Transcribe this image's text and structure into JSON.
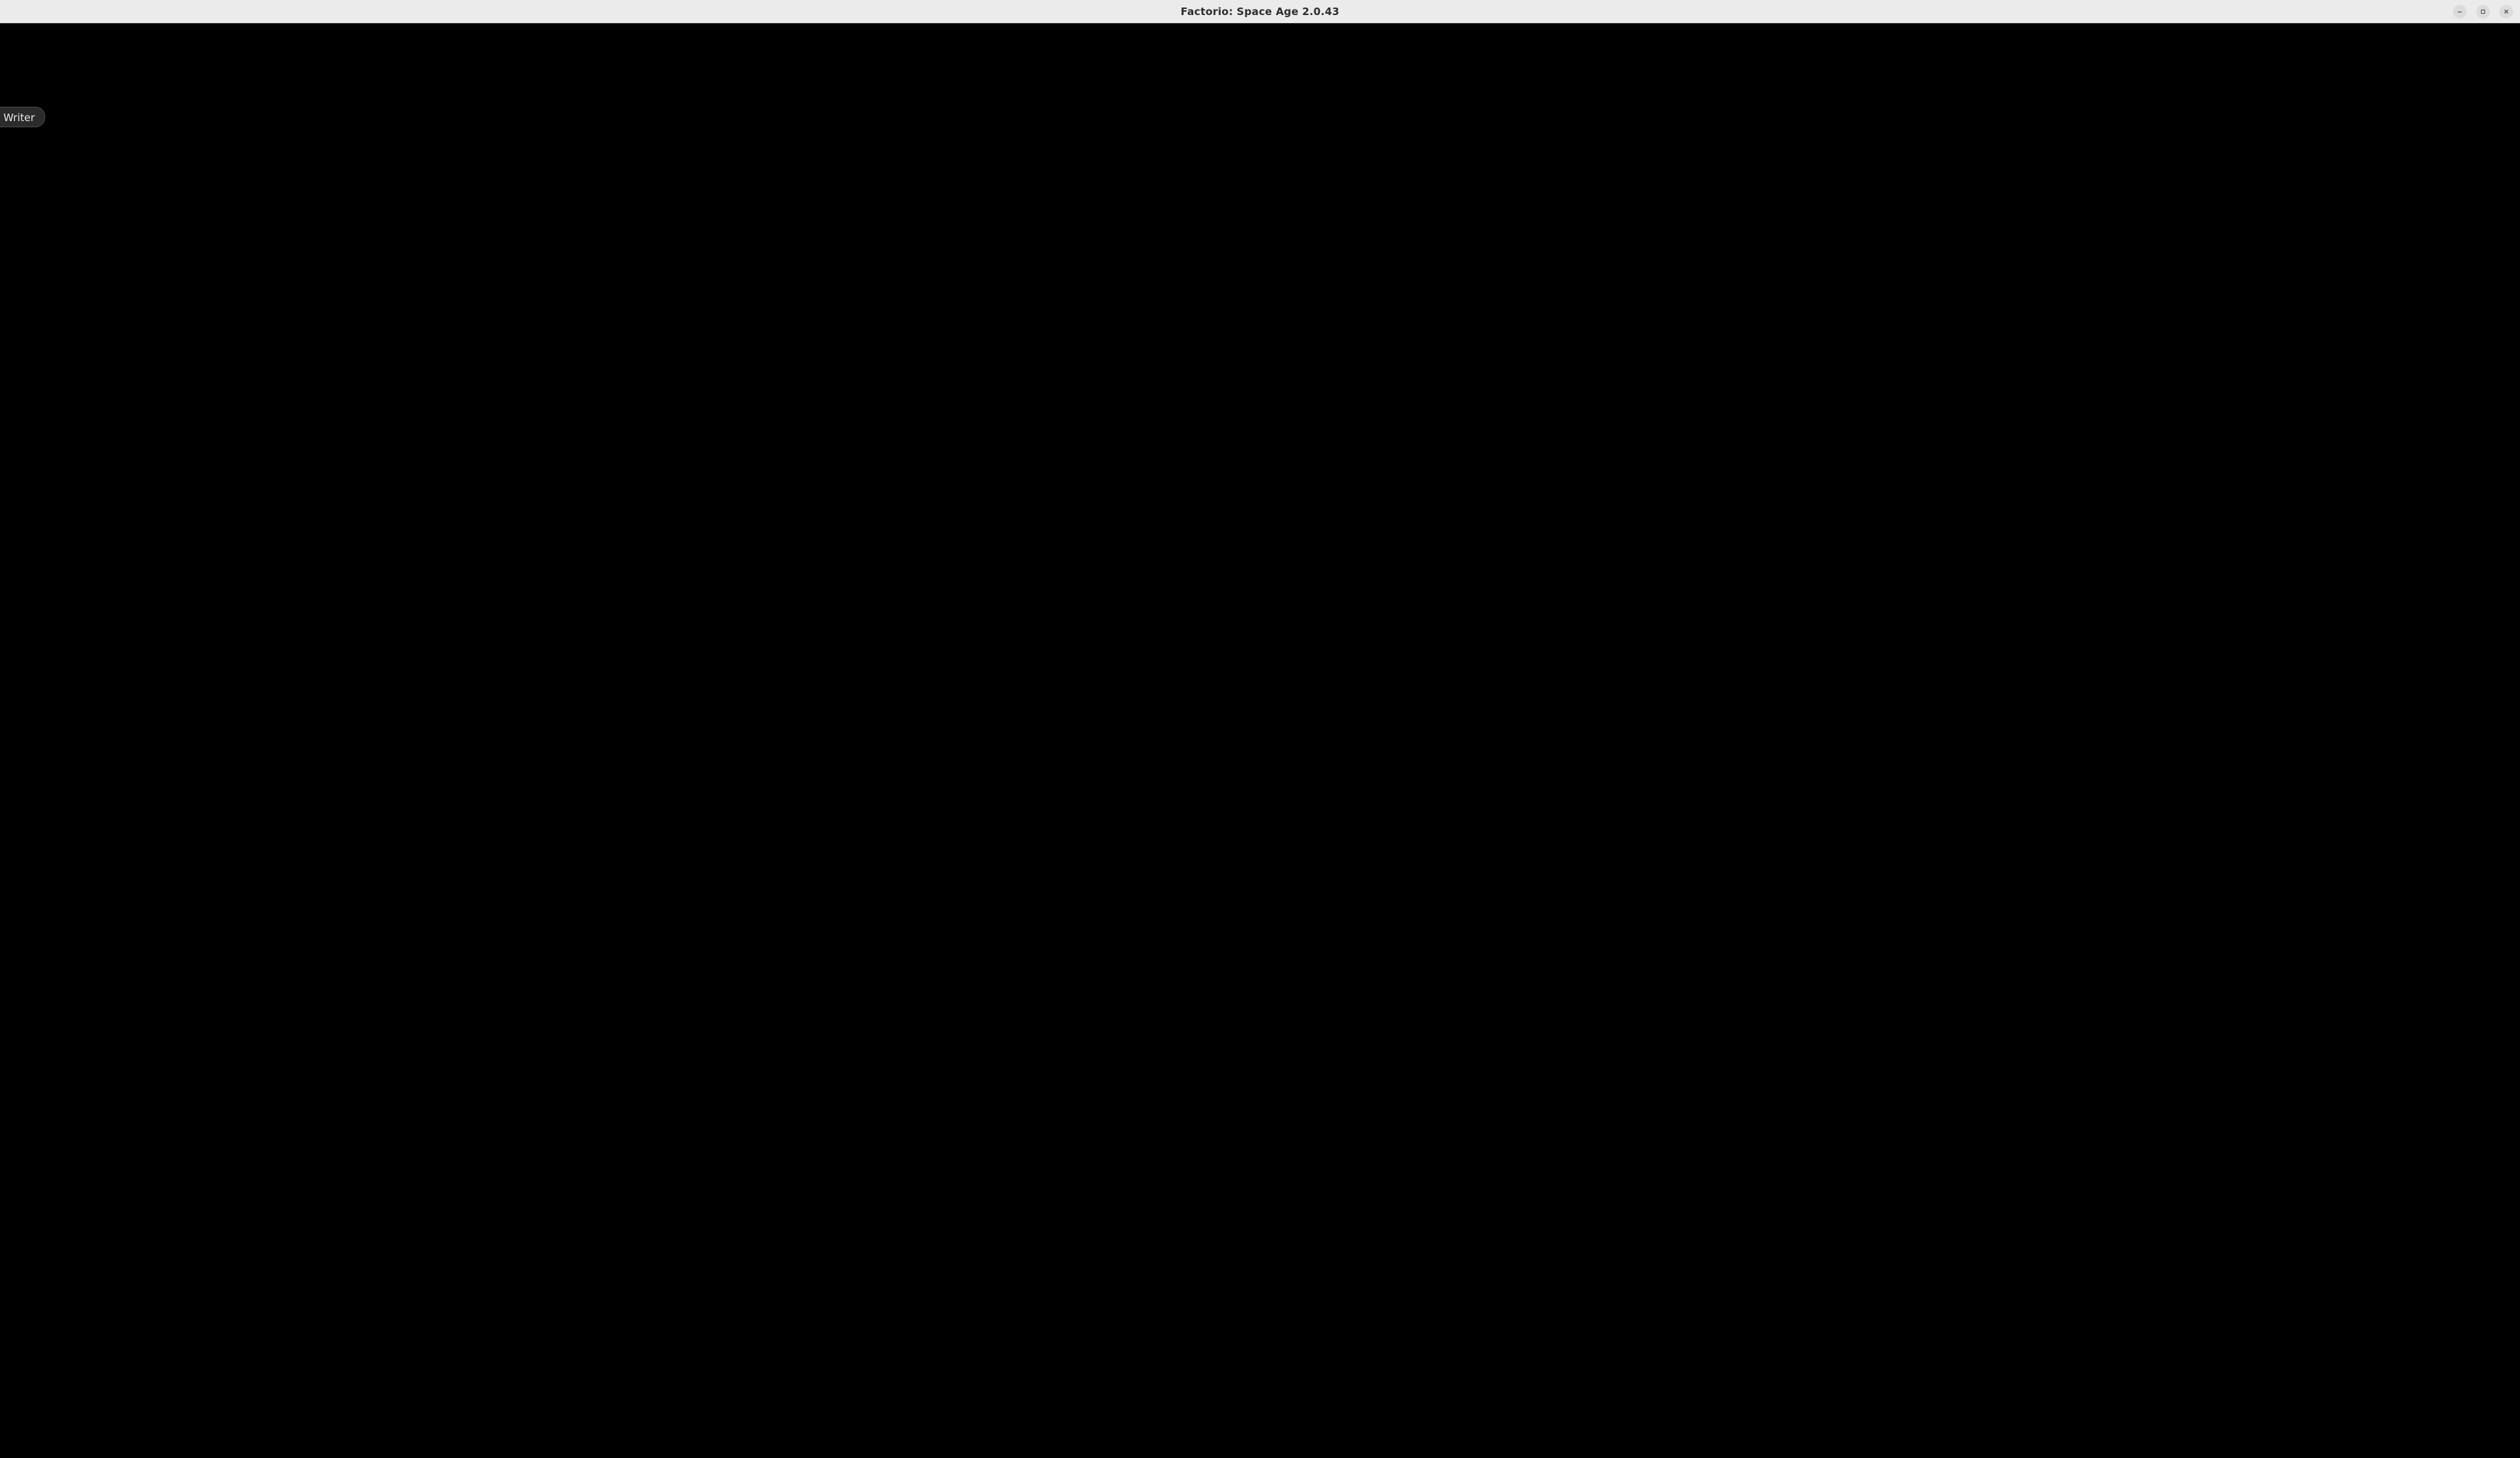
{
  "window": {
    "title": "Factorio: Space Age 2.0.43",
    "controls": {
      "minimize_icon": "minimize-icon",
      "maximize_icon": "maximize-icon",
      "close_icon": "close-icon"
    }
  },
  "desktop": {
    "app_label": "Writer"
  },
  "colors": {
    "titlebar_bg": "#ebebeb",
    "content_bg": "#000000",
    "label_bg": "#2b2b2b"
  }
}
